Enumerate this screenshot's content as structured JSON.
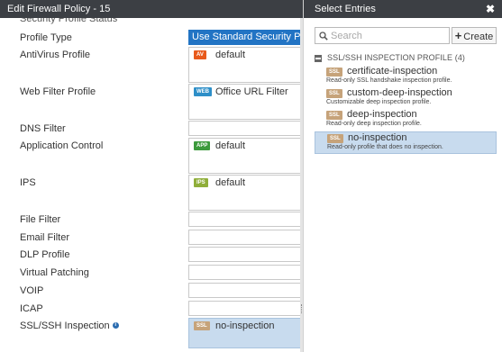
{
  "policy_editor": {
    "title": "Edit Firewall Policy - 15",
    "partial_row_label": "Security Profile Status",
    "rows": [
      {
        "label": "Profile Type",
        "value": "Use Standard Security Profile"
      },
      {
        "label": "AntiVirus Profile",
        "badge": "AV",
        "value": "default"
      },
      {
        "label": "Web Filter Profile",
        "badge": "WEB",
        "value": "Office URL Filter"
      },
      {
        "label": "DNS Filter",
        "value": ""
      },
      {
        "label": "Application Control",
        "badge": "APP",
        "value": "default"
      },
      {
        "label": "IPS",
        "badge": "IPS",
        "value": "default"
      },
      {
        "label": "File Filter",
        "value": ""
      },
      {
        "label": "Email Filter",
        "value": ""
      },
      {
        "label": "DLP Profile",
        "value": ""
      },
      {
        "label": "Virtual Patching",
        "value": ""
      },
      {
        "label": "VOIP",
        "value": ""
      },
      {
        "label": "ICAP",
        "value": ""
      },
      {
        "label": "SSL/SSH Inspection",
        "badge": "SSL",
        "value": "no-inspection",
        "info_icon": "info-icon"
      }
    ]
  },
  "select_entries": {
    "title": "Select Entries",
    "close_label": "✖",
    "search": {
      "placeholder": "Search",
      "value": ""
    },
    "create_label": "Create",
    "group": {
      "label": "SSL/SSH INSPECTION PROFILE (4)",
      "icon": "collapse-icon"
    },
    "entries": [
      {
        "badge": "SSL",
        "name": "certificate-inspection",
        "description": "Read-only SSL handshake inspection profile.",
        "selected": false
      },
      {
        "badge": "SSL",
        "name": "custom-deep-inspection",
        "description": "Customizable deep inspection profile.",
        "selected": false
      },
      {
        "badge": "SSL",
        "name": "deep-inspection",
        "description": "Read-only deep inspection profile.",
        "selected": false
      },
      {
        "badge": "SSL",
        "name": "no-inspection",
        "description": "Read-only profile that does no inspection.",
        "selected": true
      }
    ]
  },
  "colors": {
    "header_bg": "#3c3f44",
    "primary_blue": "#2274c4",
    "selection_bg": "#c8dbee",
    "av_badge": "#e85a1c",
    "web_badge": "#2e8fc8",
    "app_badge": "#3c9a3c",
    "ips_badge": "#8fae3a",
    "ssl_badge": "#c6a37a"
  }
}
